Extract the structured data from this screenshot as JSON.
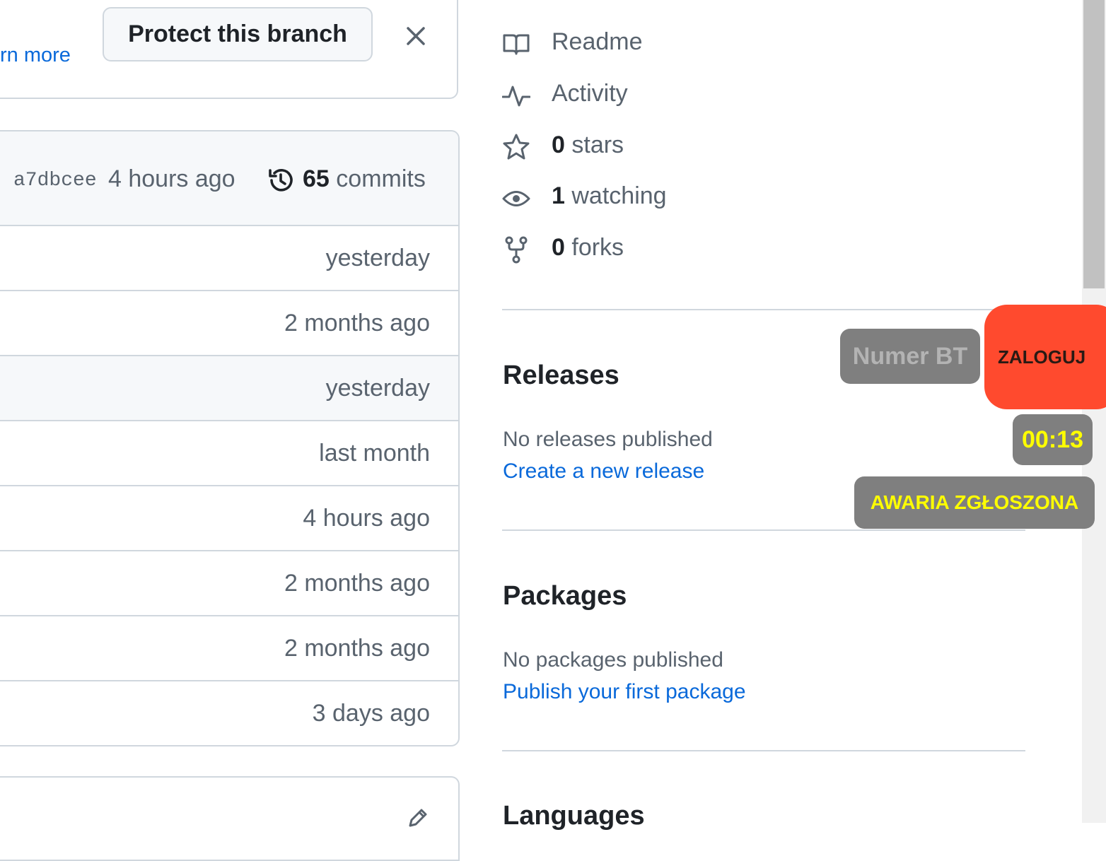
{
  "banner": {
    "learn_more": "rn more",
    "protect_button": "Protect this branch"
  },
  "commit_header": {
    "sha": "a7dbcee",
    "time": "4 hours ago",
    "commits_count": "65",
    "commits_label": "commits"
  },
  "file_rows": [
    {
      "time": "yesterday"
    },
    {
      "time": "2 months ago"
    },
    {
      "time": "yesterday"
    },
    {
      "time": "last month"
    },
    {
      "time": "4 hours ago"
    },
    {
      "time": "2 months ago"
    },
    {
      "time": "2 months ago"
    },
    {
      "time": "3 days ago"
    }
  ],
  "sidebar": {
    "readme": "Readme",
    "activity": "Activity",
    "stars_count": "0",
    "stars_label": "stars",
    "watching_count": "1",
    "watching_label": "watching",
    "forks_count": "0",
    "forks_label": "forks",
    "releases_title": "Releases",
    "releases_empty": "No releases published",
    "releases_link": "Create a new release",
    "packages_title": "Packages",
    "packages_empty": "No packages published",
    "packages_link": "Publish your first package",
    "languages_title": "Languages"
  },
  "overlay": {
    "numer_bt": "Numer BT",
    "zaloguj": "ZALOGUJ",
    "timer": "00:13",
    "awaria": "AWARIA ZGŁOSZONA"
  },
  "colors": {
    "link": "#0969da",
    "muted": "#59636e",
    "border": "#d0d7de",
    "zaloguj_bg": "#ff4a2e",
    "overlay_bg": "#7f7f7f",
    "overlay_text": "#ffff00"
  },
  "icons": [
    "x-icon",
    "history-icon",
    "pencil-icon",
    "book-icon",
    "pulse-icon",
    "star-icon",
    "eye-icon",
    "repo-forked-icon"
  ]
}
